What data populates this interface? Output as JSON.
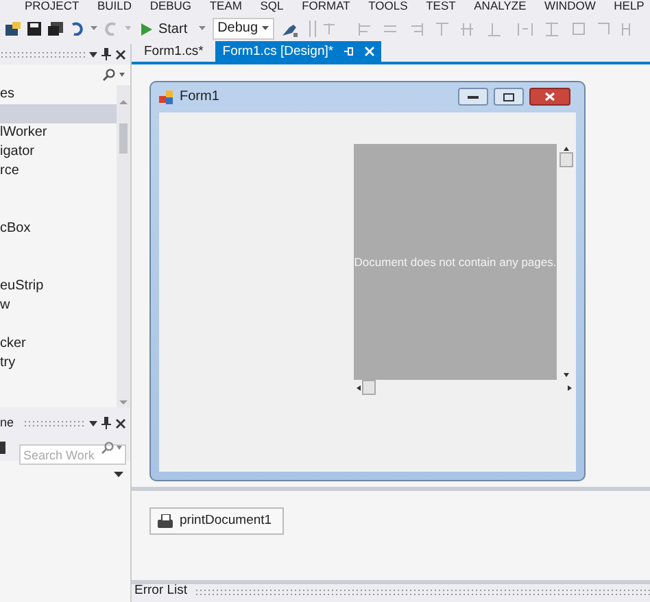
{
  "menu": [
    "PROJECT",
    "BUILD",
    "DEBUG",
    "TEAM",
    "SQL",
    "FORMAT",
    "TOOLS",
    "TEST",
    "ANALYZE",
    "WINDOW",
    "HELP"
  ],
  "toolbar": {
    "start": "Start",
    "configuration": "Debug"
  },
  "toolbox": {
    "items": [
      {
        "label": "es",
        "selected": false
      },
      {
        "selected": true
      },
      {
        "label": "lWorker",
        "selected": false
      },
      {
        "label": "igator",
        "selected": false
      },
      {
        "label": "rce",
        "selected": false
      },
      {
        "selected": false
      },
      {
        "selected": false
      },
      {
        "label": "cBox",
        "selected": false
      },
      {
        "selected": false
      },
      {
        "selected": false
      },
      {
        "label": "euStrip",
        "selected": false
      },
      {
        "label": "w",
        "selected": false
      },
      {
        "selected": false
      },
      {
        "label": "cker",
        "selected": false
      },
      {
        "label": "try",
        "selected": false
      }
    ]
  },
  "team_panel": {
    "title": "ne",
    "search": {
      "placeholder": "Search Work"
    }
  },
  "tabs": [
    {
      "label": "Form1.cs*",
      "selected": false
    },
    {
      "label": "Form1.cs [Design]*",
      "selected": true
    }
  ],
  "form": {
    "title": "Form1",
    "preview": {
      "message": "Document does not contain any pages."
    }
  },
  "tray": [
    "printDocument1"
  ],
  "bottom_panel": {
    "title": "Error List"
  }
}
